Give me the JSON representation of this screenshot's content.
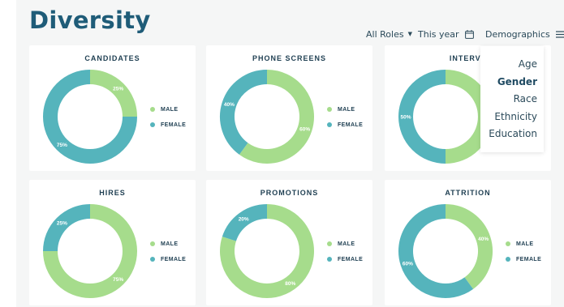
{
  "page": {
    "title": "Diversity"
  },
  "toolbar": {
    "roles_label": "All Roles",
    "period_label": "This year",
    "view_label": "Demographics"
  },
  "menu": {
    "items": [
      "Age",
      "Gender",
      "Race",
      "Ethnicity",
      "Education"
    ],
    "selected": "Gender"
  },
  "colors": {
    "male": "#a6dc8c",
    "female": "#55b4bc",
    "title": "#1f5c78"
  },
  "chart_data": [
    {
      "type": "pie",
      "title": "CANDIDATES",
      "legend": [
        "MALE",
        "FEMALE"
      ],
      "values": [
        25,
        75
      ],
      "labels": [
        "25%",
        "75%"
      ]
    },
    {
      "type": "pie",
      "title": "PHONE SCREENS",
      "legend": [
        "MALE",
        "FEMALE"
      ],
      "values": [
        60,
        40
      ],
      "labels": [
        "60%",
        "40%"
      ]
    },
    {
      "type": "pie",
      "title": "INTERVIE",
      "legend": [
        "MALE",
        "FEMALE"
      ],
      "values": [
        50,
        50
      ],
      "labels": [
        "50",
        "50%"
      ]
    },
    {
      "type": "pie",
      "title": "HIRES",
      "legend": [
        "MALE",
        "FEMALE"
      ],
      "values": [
        75,
        25
      ],
      "labels": [
        "75%",
        "25%"
      ]
    },
    {
      "type": "pie",
      "title": "PROMOTIONS",
      "legend": [
        "MALE",
        "FEMALE"
      ],
      "values": [
        80,
        20
      ],
      "labels": [
        "80%",
        "20%"
      ]
    },
    {
      "type": "pie",
      "title": "ATTRITION",
      "legend": [
        "MALE",
        "FEMALE"
      ],
      "values": [
        40,
        60
      ],
      "labels": [
        "40%",
        "60%"
      ]
    }
  ]
}
